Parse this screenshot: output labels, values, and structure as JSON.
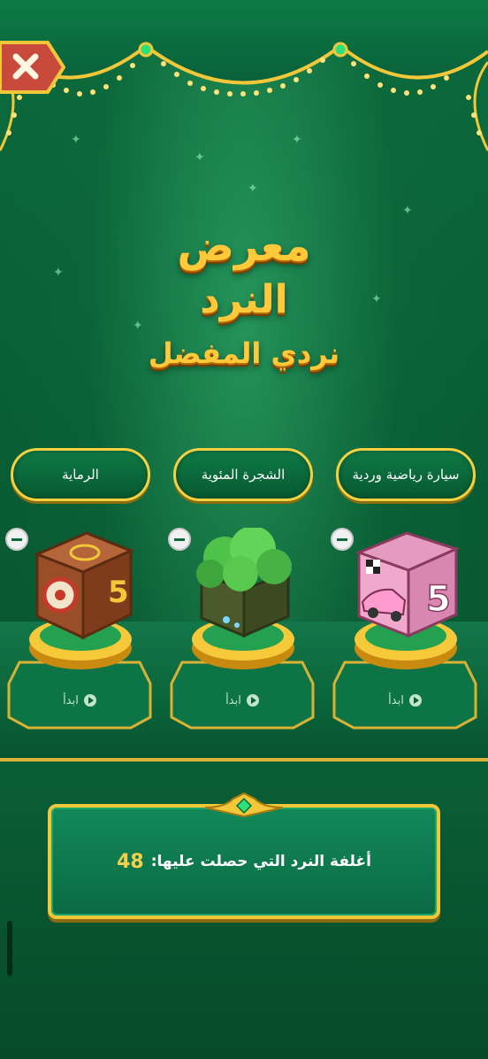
{
  "header": {
    "close_icon": "close-icon"
  },
  "title": {
    "line1": "معرض",
    "line2": "النرد",
    "subtitle": "نردي المفضل"
  },
  "categories": [
    {
      "label": "الرماية"
    },
    {
      "label": "الشجرة المئوية"
    },
    {
      "label": "سيارة رياضية وردية"
    }
  ],
  "dice_slots": [
    {
      "name": "archery-dice",
      "start_label": "ابدأ"
    },
    {
      "name": "tree-dice",
      "start_label": "ابدأ"
    },
    {
      "name": "pink-car-dice",
      "start_label": "ابدأ"
    }
  ],
  "info": {
    "label": "أغلفة النرد التي حصلت عليها:",
    "count": "48"
  },
  "colors": {
    "gold": "#f2c73a",
    "green": "#0b6a3c",
    "title_gold": "#ffc93a"
  }
}
